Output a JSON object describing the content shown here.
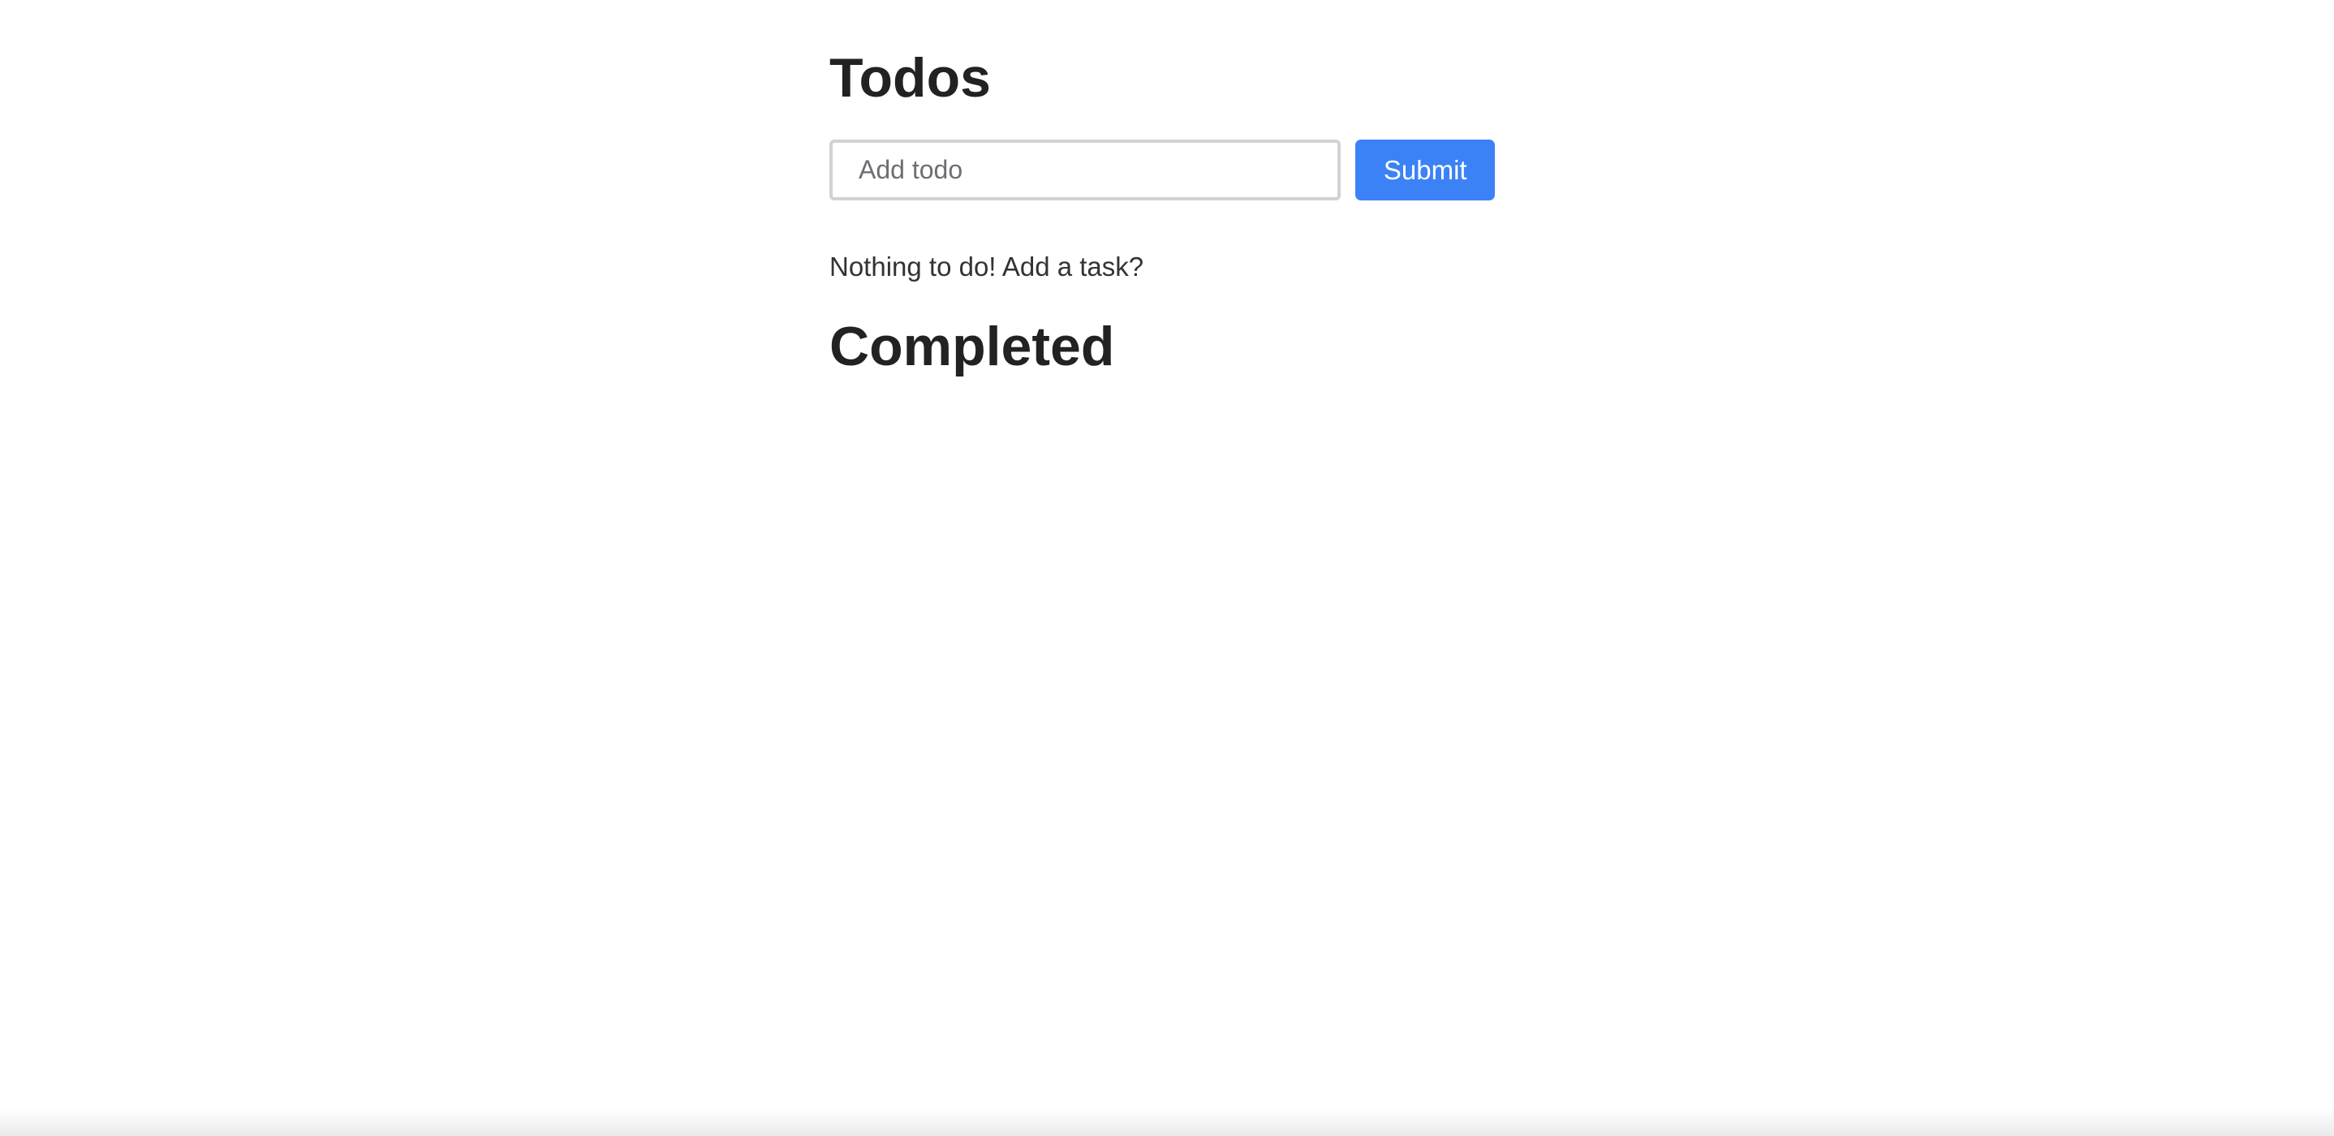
{
  "header": {
    "title": "Todos"
  },
  "form": {
    "input_placeholder": "Add todo",
    "input_value": "",
    "submit_label": "Submit"
  },
  "todos": {
    "empty_message": "Nothing to do! Add a task?"
  },
  "completed": {
    "title": "Completed"
  },
  "colors": {
    "accent": "#3b82f6",
    "text": "#222222",
    "input_border": "#cfd3d6"
  }
}
